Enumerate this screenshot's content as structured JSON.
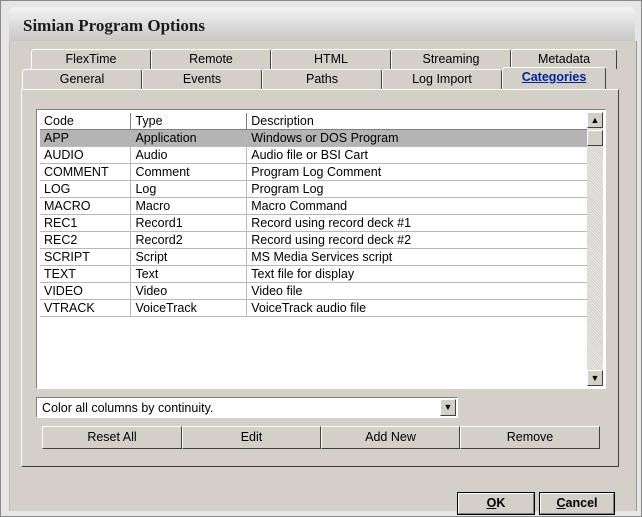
{
  "window": {
    "title": "Simian Program Options"
  },
  "tabs": {
    "row1": [
      "FlexTime",
      "Remote",
      "HTML",
      "Streaming",
      "Metadata"
    ],
    "row2": [
      "General",
      "Events",
      "Paths",
      "Log Import",
      "Categories"
    ],
    "active": "Categories"
  },
  "grid": {
    "columns": [
      "Code",
      "Type",
      "Description"
    ],
    "rows": [
      [
        "APP",
        "Application",
        "Windows or DOS Program"
      ],
      [
        "AUDIO",
        "Audio",
        "Audio file or BSI Cart"
      ],
      [
        "COMMENT",
        "Comment",
        "Program Log Comment"
      ],
      [
        "LOG",
        "Log",
        "Program Log"
      ],
      [
        "MACRO",
        "Macro",
        "Macro Command"
      ],
      [
        "REC1",
        "Record1",
        "Record using record deck #1"
      ],
      [
        "REC2",
        "Record2",
        "Record using record deck #2"
      ],
      [
        "SCRIPT",
        "Script",
        "MS Media Services script"
      ],
      [
        "TEXT",
        "Text",
        "Text file for display"
      ],
      [
        "VIDEO",
        "Video",
        "Video file"
      ],
      [
        "VTRACK",
        "VoiceTrack",
        "VoiceTrack audio file"
      ]
    ],
    "selected_row": 0
  },
  "color_select": {
    "value": "Color all columns by continuity."
  },
  "buttons": {
    "reset_all": "Reset All",
    "edit": "Edit",
    "add_new": "Add New",
    "remove": "Remove",
    "ok_underline": "O",
    "ok_rest": "K",
    "cancel_underline": "C",
    "cancel_rest": "ancel"
  }
}
